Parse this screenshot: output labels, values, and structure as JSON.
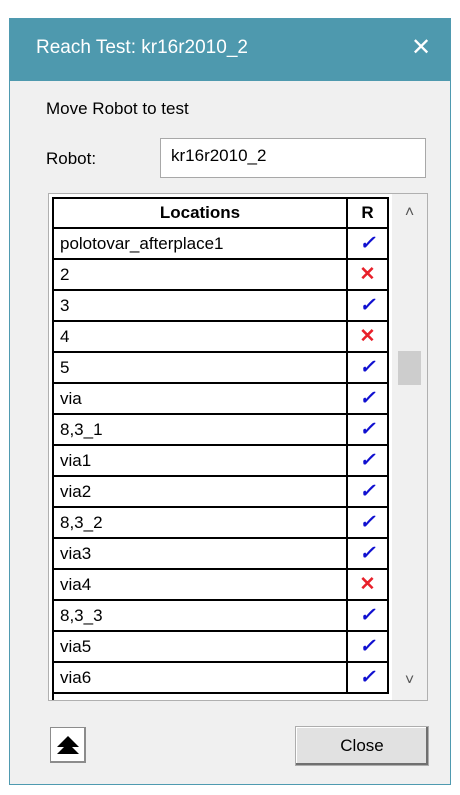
{
  "window": {
    "title": "Reach Test: kr16r2010_2",
    "close_glyph": "✕",
    "title_bar_color": "#4e99ae"
  },
  "subtitle": "Move Robot to test",
  "robot": {
    "label": "Robot:",
    "value": "kr16r2010_2"
  },
  "table": {
    "headers": {
      "locations": "Locations",
      "reach": "R"
    },
    "rows": [
      {
        "location": "polotovar_afterplace1",
        "reachable": true,
        "mark": "✓"
      },
      {
        "location": "2",
        "reachable": false,
        "mark": "✕"
      },
      {
        "location": "3",
        "reachable": true,
        "mark": "✓"
      },
      {
        "location": "4",
        "reachable": false,
        "mark": "✕"
      },
      {
        "location": "5",
        "reachable": true,
        "mark": "✓"
      },
      {
        "location": "via",
        "reachable": true,
        "mark": "✓"
      },
      {
        "location": "8,3_1",
        "reachable": true,
        "mark": "✓"
      },
      {
        "location": "via1",
        "reachable": true,
        "mark": "✓"
      },
      {
        "location": "via2",
        "reachable": true,
        "mark": "✓"
      },
      {
        "location": "8,3_2",
        "reachable": true,
        "mark": "✓"
      },
      {
        "location": "via3",
        "reachable": true,
        "mark": "✓"
      },
      {
        "location": "via4",
        "reachable": false,
        "mark": "✕"
      },
      {
        "location": "8,3_3",
        "reachable": true,
        "mark": "✓"
      },
      {
        "location": "via5",
        "reachable": true,
        "mark": "✓"
      },
      {
        "location": "via6",
        "reachable": true,
        "mark": "✓"
      }
    ],
    "ok_color": "#1010d0",
    "fail_color": "#e8202a"
  },
  "scrollbar": {
    "up_glyph": "˄",
    "down_glyph": "˅"
  },
  "buttons": {
    "move_up_icon": "up-arrow-icon",
    "close_label": "Close"
  }
}
